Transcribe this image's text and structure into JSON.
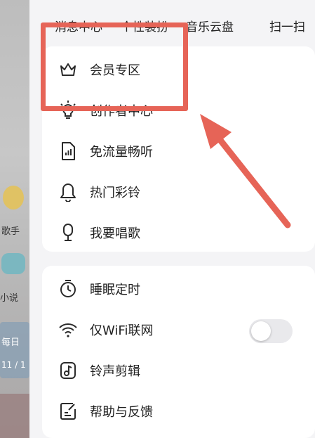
{
  "background": {
    "labels": [
      "歌手",
      "小说"
    ],
    "date_fragment": "11 / 1",
    "day_fragment": "每日"
  },
  "topbar": {
    "items": [
      "消息中心",
      "个性装扮",
      "音乐云盘",
      "扫一扫"
    ]
  },
  "menu_group_1": [
    {
      "label": "会员专区",
      "icon": "crown-icon"
    },
    {
      "label": "创作者中心",
      "icon": "lightbulb-icon"
    },
    {
      "label": "免流量畅听",
      "icon": "data-plan-icon"
    },
    {
      "label": "热门彩铃",
      "icon": "bell-icon"
    },
    {
      "label": "我要唱歌",
      "icon": "microphone-icon"
    }
  ],
  "menu_group_2": [
    {
      "label": "睡眠定时",
      "icon": "timer-icon"
    },
    {
      "label": "仅WiFi联网",
      "icon": "wifi-icon",
      "toggle": false
    },
    {
      "label": "铃声剪辑",
      "icon": "music-note-icon"
    },
    {
      "label": "帮助与反馈",
      "icon": "feedback-icon"
    }
  ],
  "colors": {
    "highlight": "#e66457",
    "icon_stroke": "#2a2a2a"
  }
}
